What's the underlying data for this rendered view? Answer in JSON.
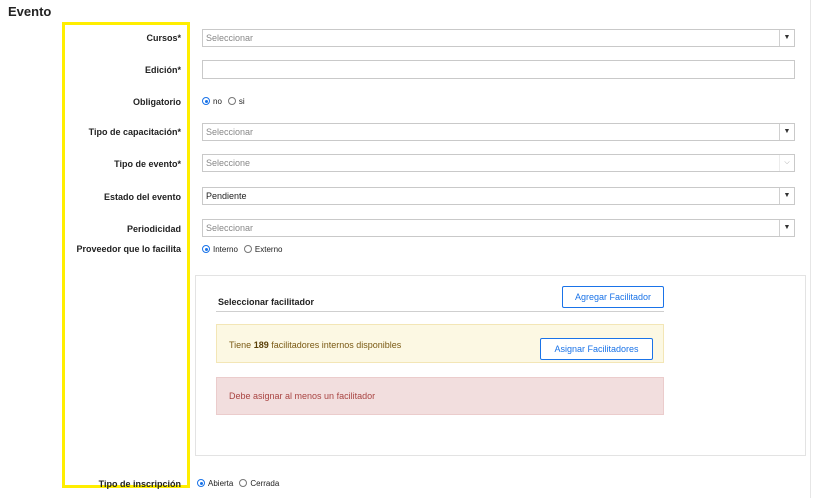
{
  "page_title": "Evento",
  "fields": {
    "cursos": {
      "label": "Cursos*",
      "placeholder": "Seleccionar"
    },
    "edicion": {
      "label": "Edición*",
      "value": ""
    },
    "obligatorio": {
      "label": "Obligatorio",
      "options": [
        "no",
        "si"
      ],
      "selected": "no"
    },
    "tipo_capacitacion": {
      "label": "Tipo de capacitación*",
      "placeholder": "Seleccionar"
    },
    "tipo_evento": {
      "label": "Tipo de evento*",
      "placeholder": "Seleccione"
    },
    "estado_evento": {
      "label": "Estado del evento",
      "value": "Pendiente"
    },
    "periodicidad": {
      "label": "Periodicidad",
      "placeholder": "Seleccionar"
    },
    "proveedor": {
      "label": "Proveedor que lo facilita",
      "options": [
        "Interno",
        "Externo"
      ],
      "selected": "Interno"
    },
    "tipo_inscripcion": {
      "label": "Tipo de inscripción",
      "options": [
        "Abierta",
        "Cerrada"
      ],
      "selected": "Abierta"
    }
  },
  "facilitador": {
    "title": "Seleccionar facilitador",
    "add_button": "Agregar Facilitador",
    "info_prefix": "Tiene ",
    "info_count": "189",
    "info_suffix": " facilitadores internos disponibles",
    "assign_button": "Asignar Facilitadores",
    "error": "Debe asignar al menos un facilitador"
  },
  "colors": {
    "accent": "#1a73e8",
    "highlight": "#ffee00",
    "warning_bg": "#fcf8e3",
    "danger_bg": "#f2dede",
    "danger_text": "#a94442"
  },
  "icons": {
    "dropdown": "caret-down-icon"
  }
}
